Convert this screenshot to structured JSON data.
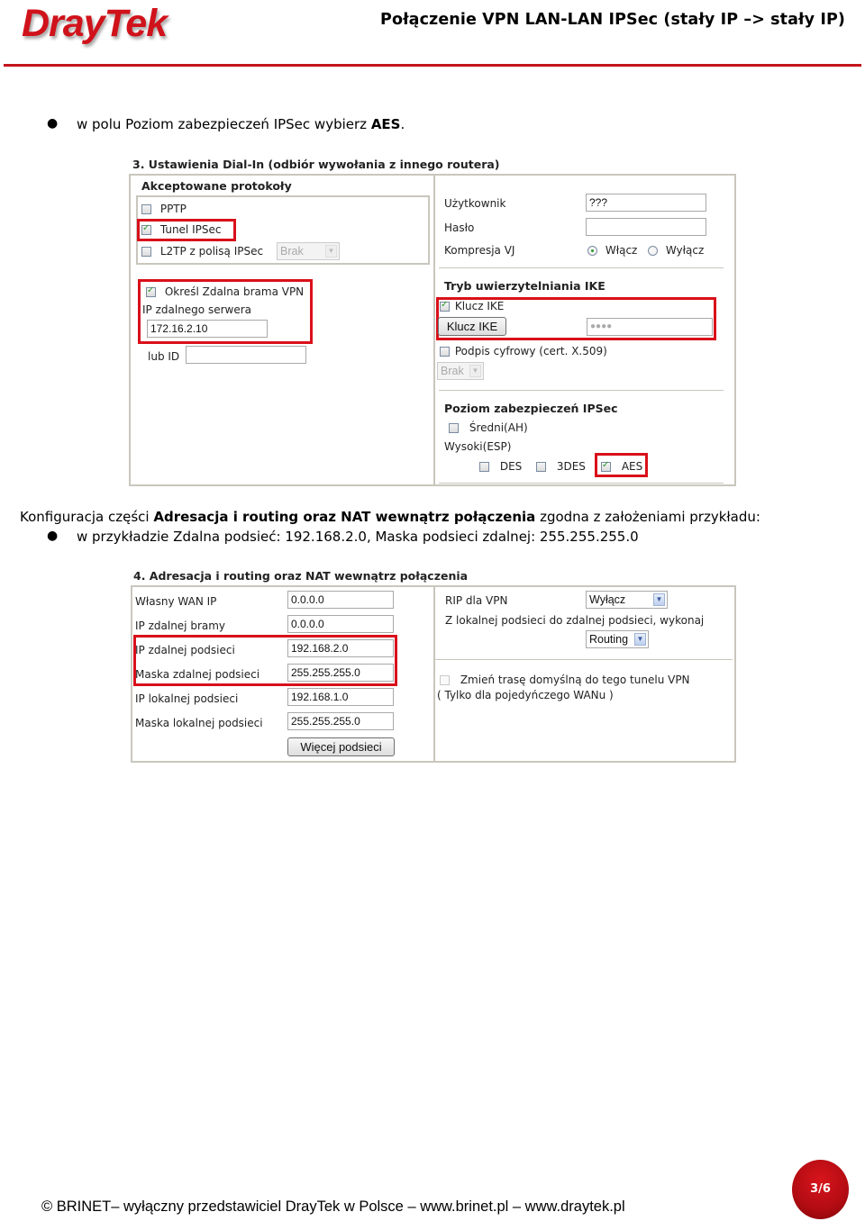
{
  "header": {
    "logo": "DrayTek",
    "title": "Połączenie VPN LAN-LAN IPSec (stały IP –> stały IP)",
    "brand_color": "#c4141c"
  },
  "intro": {
    "bullet_prefix": "w polu Poziom zabezpieczeń IPSec wybierz ",
    "bullet_bold": "AES",
    "bullet_suffix": "."
  },
  "dialin": {
    "title": "3. Ustawienia Dial-In (odbiór wywołania z innego routera)",
    "protocols_heading": "Akceptowane protokoły",
    "protocols": [
      {
        "label": "PPTP",
        "checked": false
      },
      {
        "label": "Tunel IPSec",
        "checked": true
      },
      {
        "label": "L2TP z polisą IPSec",
        "checked": false
      }
    ],
    "l2tp_policy_select": "Brak",
    "remote_gateway_label": "Określ Zdalna brama VPN",
    "remote_gateway_checked": true,
    "remote_server_ip_label": "IP zdalnego serwera",
    "remote_server_ip": "172.16.2.10",
    "or_id_label": "lub ID",
    "or_id_value": "",
    "user_label": "Użytkownik",
    "user_value": "???",
    "password_label": "Hasło",
    "password_value": "",
    "vj_label": "Kompresja VJ",
    "vj_on": "Włącz",
    "vj_off": "Wyłącz",
    "vj_selected": "Włącz",
    "ike_heading": "Tryb uwierzytelniania IKE",
    "ike_key_label": "Klucz IKE",
    "ike_key_checked": true,
    "ike_key_button": "Klucz IKE",
    "ike_key_value": "●●●●",
    "cert_label": "Podpis cyfrowy (cert. X.509)",
    "cert_checked": false,
    "cert_select": "Brak",
    "security_heading": "Poziom zabezpieczeń IPSec",
    "medium_label": "Średni(AH)",
    "medium_checked": false,
    "high_label": "Wysoki(ESP)",
    "esp_options": [
      {
        "label": "DES",
        "checked": false
      },
      {
        "label": "3DES",
        "checked": false
      },
      {
        "label": "AES",
        "checked": true
      }
    ]
  },
  "middle": {
    "line_prefix": "Konfiguracja części ",
    "line_bold": "Adresacja i routing oraz NAT wewnątrz połączenia",
    "line_suffix": " zgodna z założeniami przykładu:",
    "bullet": "w przykładzie Zdalna podsieć: 192.168.2.0, Maska podsieci zdalnej: 255.255.255.0"
  },
  "routing": {
    "title": "4. Adresacja i routing oraz NAT wewnątrz połączenia",
    "fields": [
      {
        "label": "Własny WAN IP",
        "value": "0.0.0.0"
      },
      {
        "label": "IP zdalnej bramy",
        "value": "0.0.0.0"
      },
      {
        "label": "IP zdalnej podsieci",
        "value": "192.168.2.0"
      },
      {
        "label": "Maska zdalnej podsieci",
        "value": "255.255.255.0"
      },
      {
        "label": "IP lokalnej podsieci",
        "value": "192.168.1.0"
      },
      {
        "label": "Maska lokalnej podsieci",
        "value": "255.255.255.0"
      }
    ],
    "more_subnets_button": "Więcej podsieci",
    "rip_label": "RIP dla VPN",
    "rip_value": "Wyłącz",
    "direction_label": "Z lokalnej podsieci do zdalnej podsieci, wykonaj",
    "direction_value": "Routing",
    "default_route_label": "Zmień trasę domyślną do tego tunelu VPN",
    "default_route_checked": false,
    "default_route_note": "( Tylko dla pojedyńczego WANu )"
  },
  "footer": {
    "text": "© BRINET– wyłączny przedstawiciel DrayTek w Polsce – www.brinet.pl – www.draytek.pl",
    "page": "3/6"
  }
}
